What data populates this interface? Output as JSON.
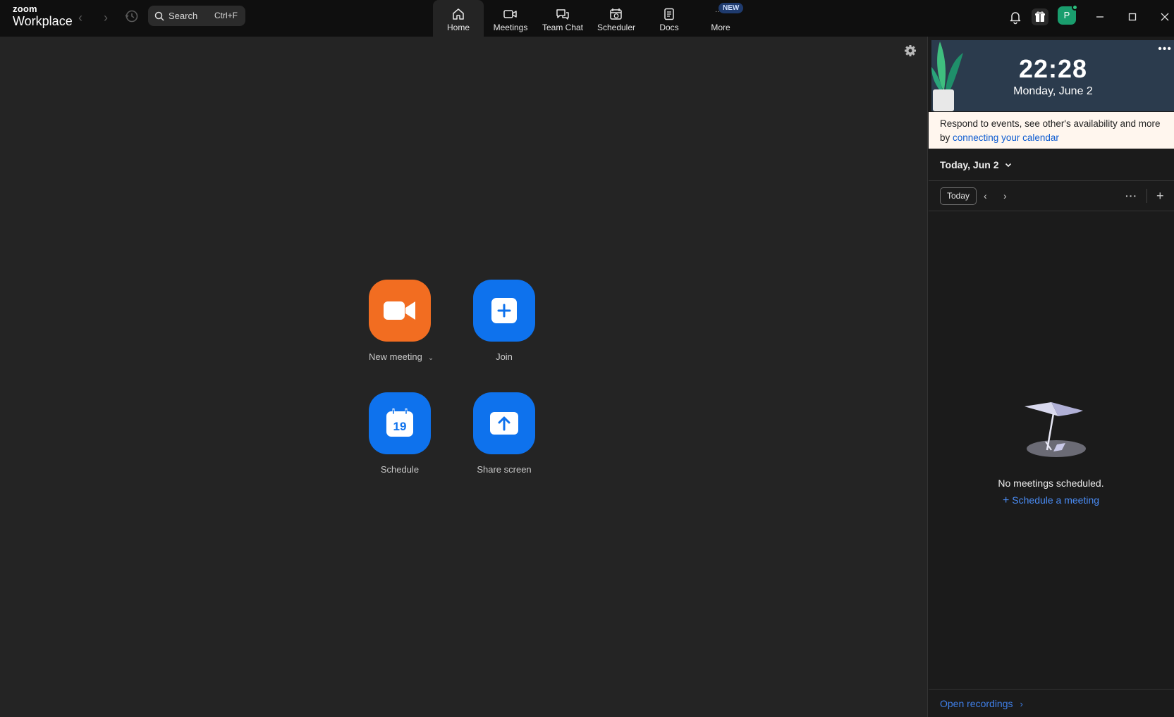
{
  "brand": {
    "line1": "zoom",
    "line2": "Workplace"
  },
  "search": {
    "placeholder": "Search",
    "shortcut": "Ctrl+F"
  },
  "tabs": [
    {
      "label": "Home",
      "icon": "home-icon",
      "active": true
    },
    {
      "label": "Meetings",
      "icon": "video-camera-icon"
    },
    {
      "label": "Team Chat",
      "icon": "chat-bubbles-icon"
    },
    {
      "label": "Scheduler",
      "icon": "calendar-clock-icon"
    },
    {
      "label": "Docs",
      "icon": "document-icon"
    },
    {
      "label": "More",
      "icon": "more-icon",
      "badge": "NEW"
    }
  ],
  "user": {
    "initial": "P",
    "status": "available"
  },
  "actions": {
    "new_meeting": "New meeting",
    "join": "Join",
    "schedule": "Schedule",
    "schedule_day": "19",
    "share_screen": "Share screen"
  },
  "panel": {
    "clock_time": "22:28",
    "clock_date": "Monday, June 2",
    "notice_text": "Respond to events, see other's availability and more by ",
    "notice_link": "connecting your calendar",
    "date_header": "Today, Jun 2",
    "today_button": "Today",
    "empty_text": "No meetings scheduled.",
    "schedule_link": "Schedule a meeting",
    "open_recordings": "Open recordings"
  },
  "colors": {
    "accent_orange": "#f26d21",
    "accent_blue": "#0e72ed",
    "link_blue": "#4a8cf5"
  }
}
